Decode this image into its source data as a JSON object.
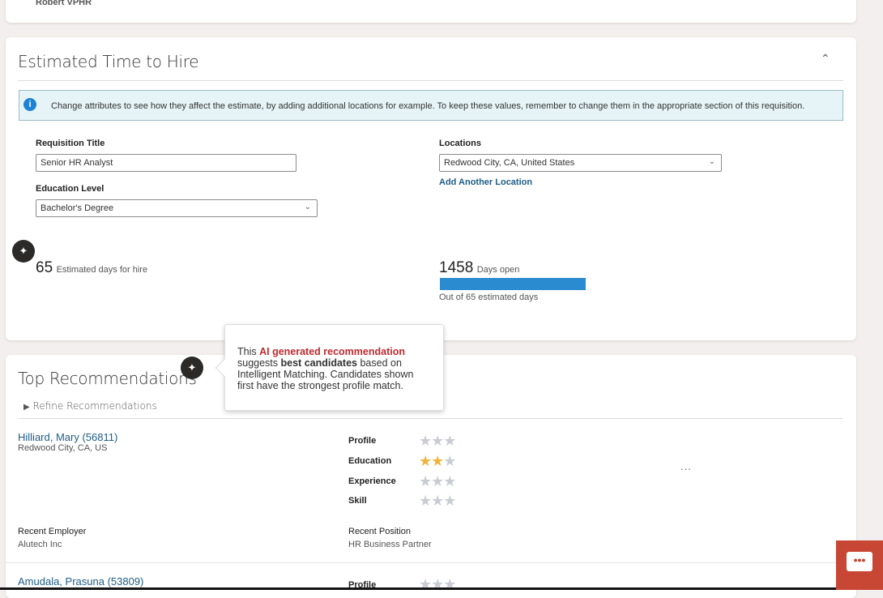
{
  "top_card": {
    "name": "Robert VPHR"
  },
  "time_to_hire": {
    "title": "Estimated Time to Hire",
    "info": "Change attributes to see how they affect the estimate, by adding additional locations for example. To keep these values, remember to change them in the appropriate section of this requisition.",
    "requisition_title_label": "Requisition Title",
    "requisition_title_value": "Senior HR Analyst",
    "education_label": "Education Level",
    "education_value": "Bachelor's Degree",
    "locations_label": "Locations",
    "location_value": "Redwood City, CA, United States",
    "add_location": "Add Another Location",
    "estimated_days": "65",
    "estimated_days_label": "Estimated days for hire",
    "days_open": "1458",
    "days_open_label": "Days open",
    "days_open_progress_percent": 100,
    "out_of": "Out of 65 estimated days"
  },
  "recommendations": {
    "title": "Top Recommendations",
    "refine": "Refine Recommendations",
    "tooltip": {
      "t1": "This ",
      "t2": "AI generated recommendation",
      "t3": " suggests ",
      "t4": "best candidates",
      "t5": " based on Intelligent Matching. Candidates shown first have the strongest profile match."
    },
    "candidates": [
      {
        "name": "Hilliard, Mary (56811)",
        "location": "Redwood City, CA, US",
        "ratings": [
          {
            "label": "Profile",
            "value": 0
          },
          {
            "label": "Education",
            "value": 2
          },
          {
            "label": "Experience",
            "value": 0
          },
          {
            "label": "Skill",
            "value": 0
          }
        ],
        "employer_label": "Recent Employer",
        "employer": "Alutech Inc",
        "position_label": "Recent Position",
        "position": "HR Business Partner",
        "more": "..."
      },
      {
        "name": "Amudala, Prasuna (53809)",
        "ratings": [
          {
            "label": "Profile",
            "value": 0
          }
        ]
      }
    ]
  },
  "colors": {
    "accent": "#2b8bd0",
    "link": "#1c5c86",
    "ai_red": "#c0282d",
    "chat": "#c74634"
  }
}
